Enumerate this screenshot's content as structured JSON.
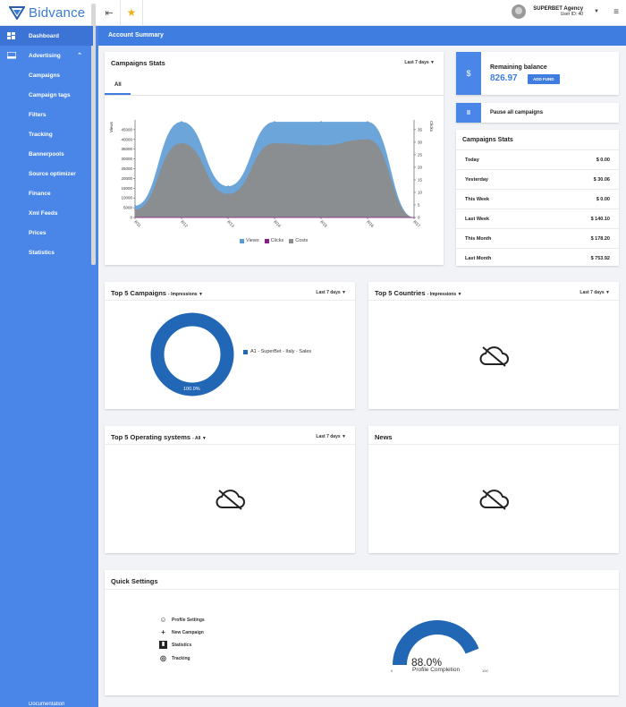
{
  "brand": {
    "name": "Bidvance"
  },
  "topbar": {
    "user_name": "SUPERBET Agency",
    "user_id": "User ID: 40"
  },
  "sidebar": {
    "items": [
      {
        "label": "Dashboard"
      },
      {
        "label": "Advertising"
      },
      {
        "label": "Campaigns"
      },
      {
        "label": "Campaign tags"
      },
      {
        "label": "Filters"
      },
      {
        "label": "Tracking"
      },
      {
        "label": "Bannerpools"
      },
      {
        "label": "Source optimizer"
      },
      {
        "label": "Finance"
      },
      {
        "label": "Xml Feeds"
      },
      {
        "label": "Prices"
      },
      {
        "label": "Statistics"
      }
    ],
    "bottom": "Documentation"
  },
  "header": {
    "title": "Account Summary"
  },
  "campaign_stats": {
    "title": "Campaigns Stats",
    "range": "Last 7 days",
    "tab": "All",
    "legend": [
      "Views",
      "Clicks",
      "Costs"
    ]
  },
  "chart_data": {
    "type": "area",
    "x": [
      "8/11",
      "8/12",
      "8/13",
      "8/14",
      "8/15",
      "8/16",
      "8/17"
    ],
    "ylabel": "Views",
    "y2label": "Clicks",
    "ylim": [
      0,
      45000
    ],
    "y_ticks": [
      0,
      5000,
      10000,
      15000,
      20000,
      25000,
      30000,
      35000,
      40000,
      45000
    ],
    "y2lim": [
      0,
      35
    ],
    "y2_ticks": [
      0,
      5,
      10,
      15,
      20,
      25,
      30,
      35
    ],
    "series": [
      {
        "name": "Views",
        "color": "#5b9bd5",
        "values": [
          6000,
          49000,
          16000,
          49000,
          49000,
          49000,
          0
        ]
      },
      {
        "name": "Clicks",
        "color": "#8a1c8a",
        "values": [
          0,
          0,
          0,
          0,
          0,
          0,
          0
        ]
      },
      {
        "name": "Costs",
        "color": "#8c8c8c",
        "values": [
          4000,
          38000,
          12000,
          38000,
          37000,
          40000,
          0
        ]
      }
    ]
  },
  "balance": {
    "label": "Remaining balance",
    "value": "826.97",
    "button": "ADD FUND",
    "icon": "$"
  },
  "pause": {
    "label": "Pause all campaigns",
    "icon": "II"
  },
  "right_stats": {
    "title": "Campaigns Stats",
    "rows": [
      {
        "label": "Today",
        "value": "$ 0.00"
      },
      {
        "label": "Yesterday",
        "value": "$ 30.06"
      },
      {
        "label": "This Week",
        "value": "$ 0.00"
      },
      {
        "label": "Last Week",
        "value": "$ 140.10"
      },
      {
        "label": "This Month",
        "value": "$ 178.20"
      },
      {
        "label": "Last Month",
        "value": "$ 753.92"
      }
    ]
  },
  "top_campaigns": {
    "title": "Top 5 Campaigns",
    "metric": "- Impressions",
    "range": "Last 7 days",
    "legend": "A1 - SuperBet - Italy - Sales",
    "percent": "100.0%",
    "share": 1.0
  },
  "top_countries": {
    "title": "Top 5 Countries",
    "metric": "- Impressions",
    "range": "Last 7 days"
  },
  "top_os": {
    "title": "Top 5 Operating systems",
    "metric": "- All",
    "range": "Last 7 days"
  },
  "news": {
    "title": "News"
  },
  "quick_settings": {
    "title": "Quick Settings",
    "items": [
      "Profile Settings",
      "New Campaign",
      "Statistics",
      "Tracking"
    ],
    "gauge_value": "88.0%",
    "gauge_fraction": 0.88,
    "gauge_label": "Profile Completion",
    "gauge_min": "0",
    "gauge_max": "100"
  },
  "colors": {
    "accent": "#3f7de0",
    "sidebar": "#4a86e8",
    "donut": "#2267b5"
  }
}
